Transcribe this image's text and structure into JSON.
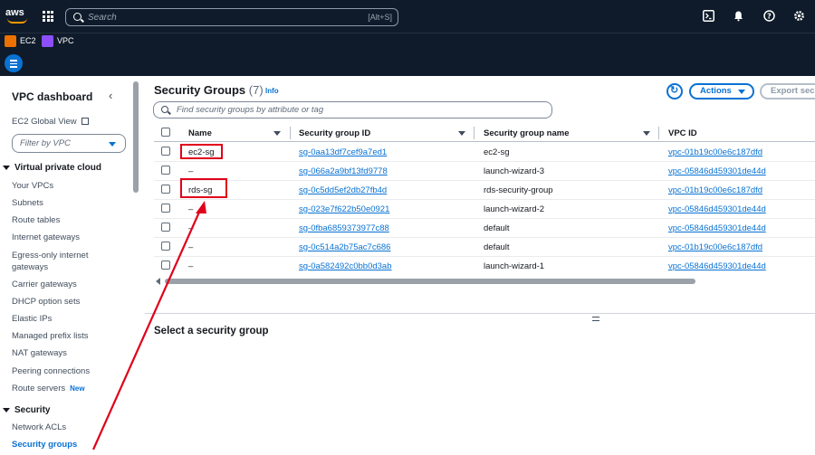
{
  "topbar": {
    "logo": "aws",
    "search_placeholder": "Search",
    "search_shortcut": "[Alt+S]",
    "icons": [
      "terminal-icon",
      "bell-icon",
      "help-icon",
      "gear-icon"
    ]
  },
  "services": [
    {
      "label": "EC2",
      "color": "#ed7100"
    },
    {
      "label": "VPC",
      "color": "#8c4fff"
    }
  ],
  "sidebar": {
    "title": "VPC dashboard",
    "global_view": "EC2 Global View",
    "filter_placeholder": "Filter by VPC",
    "section_vpc": "Virtual private cloud",
    "vpc_items": [
      "Your VPCs",
      "Subnets",
      "Route tables",
      "Internet gateways",
      "Egress-only internet",
      "gateways",
      "Carrier gateways",
      "DHCP option sets",
      "Elastic IPs",
      "Managed prefix lists",
      "NAT gateways",
      "Peering connections",
      "Route servers"
    ],
    "new_badge": "New",
    "section_security": "Security",
    "security_items": [
      "Network ACLs",
      "Security groups"
    ]
  },
  "main": {
    "title": "Security Groups",
    "count": "(7)",
    "info": "Info",
    "actions_label": "Actions",
    "export_label": "Export secu",
    "search_placeholder": "Find security groups by attribute or tag",
    "columns": [
      "Name",
      "Security group ID",
      "Security group name",
      "VPC ID"
    ],
    "rows": [
      {
        "name": "ec2-sg",
        "id": "sg-0aa13df7cef9a7ed1",
        "group_name": "ec2-sg",
        "vpc": "vpc-01b19c00e6c187dfd"
      },
      {
        "name": "–",
        "id": "sg-066a2a9bf13fd9778",
        "group_name": "launch-wizard-3",
        "vpc": "vpc-05846d459301de44d"
      },
      {
        "name": "rds-sg",
        "id": "sg-0c5dd5ef2db27fb4d",
        "group_name": "rds-security-group",
        "vpc": "vpc-01b19c00e6c187dfd"
      },
      {
        "name": "–",
        "id": "sg-023e7f622b50e0921",
        "group_name": "launch-wizard-2",
        "vpc": "vpc-05846d459301de44d"
      },
      {
        "name": "–",
        "id": "sg-0fba6859373977c88",
        "group_name": "default",
        "vpc": "vpc-05846d459301de44d"
      },
      {
        "name": "–",
        "id": "sg-0c514a2b75ac7c686",
        "group_name": "default",
        "vpc": "vpc-01b19c00e6c187dfd"
      },
      {
        "name": "–",
        "id": "sg-0a582492c0bb0d3ab",
        "group_name": "launch-wizard-1",
        "vpc": "vpc-05846d459301de44d"
      }
    ],
    "detail_title": "Select a security group"
  },
  "annotation_color": "#e0001b"
}
